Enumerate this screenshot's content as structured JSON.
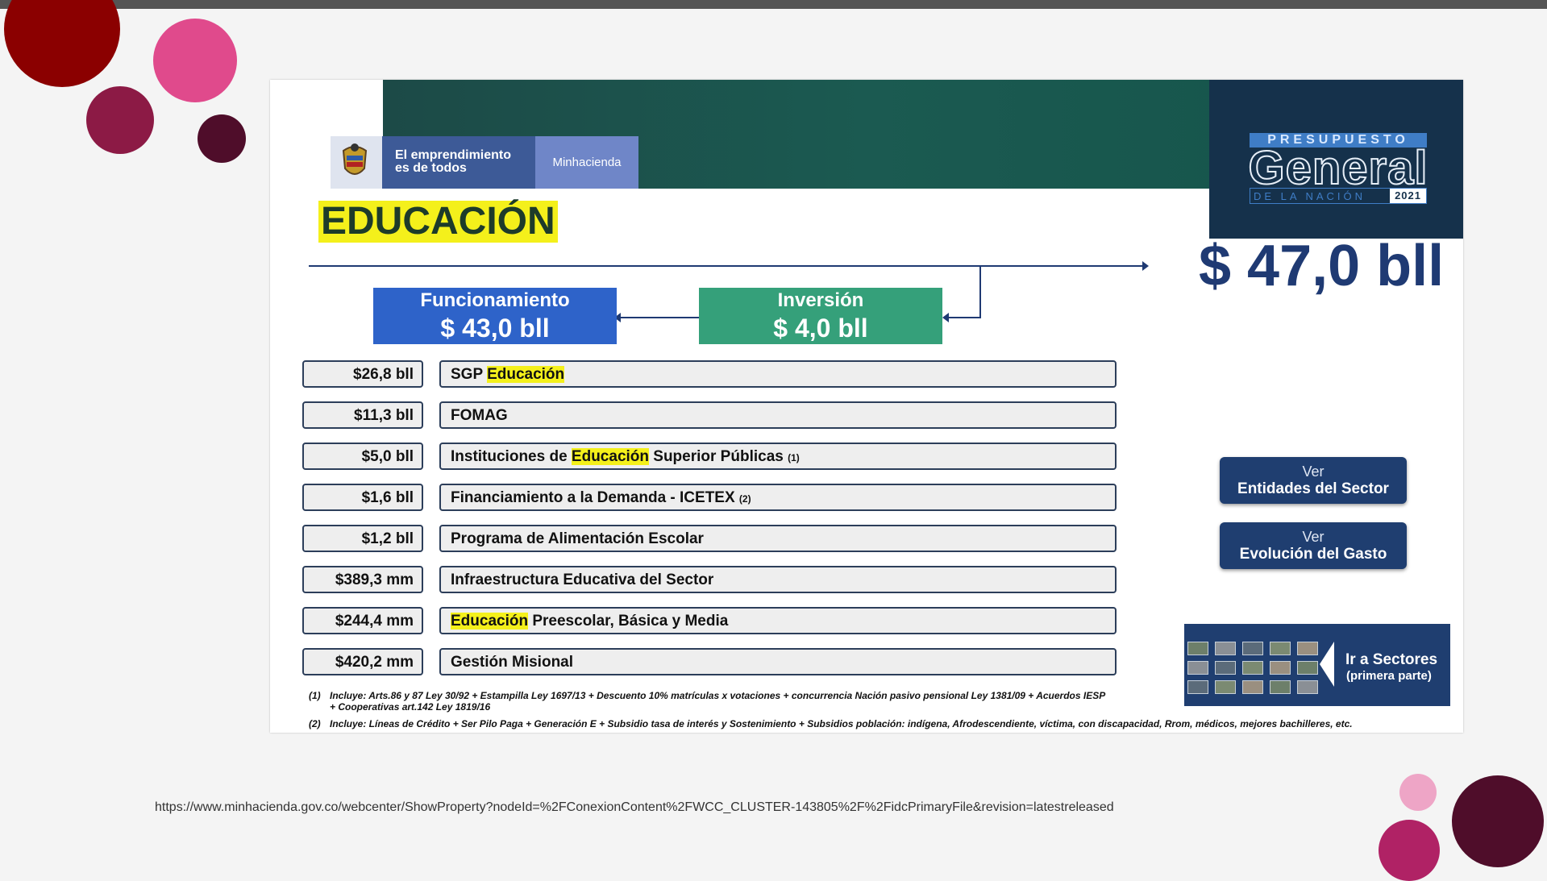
{
  "slide": {
    "header": {
      "logo_text_line1": "El emprendimiento",
      "logo_text_line2": "es de todos",
      "ministry": "Minhacienda",
      "budget_badge": {
        "top": "PRESUPUESTO",
        "main": "General",
        "bottom": "DE LA NACIÓN",
        "year": "2021"
      }
    },
    "title": "EDUCACIÓN",
    "total": "$ 47,0 bll",
    "funcionamiento": {
      "label": "Funcionamiento",
      "value": "$ 43,0 bll"
    },
    "inversion": {
      "label": "Inversión",
      "value": "$ 4,0 bll"
    },
    "rows": [
      {
        "amount": "$26,8 bll",
        "pre": "SGP ",
        "hl": "Educación",
        "post": "",
        "note": ""
      },
      {
        "amount": "$11,3 bll",
        "pre": "FOMAG",
        "hl": "",
        "post": "",
        "note": ""
      },
      {
        "amount": "$5,0 bll",
        "pre": "Instituciones de ",
        "hl": "Educación",
        "post": " Superior Públicas ",
        "note": "(1)"
      },
      {
        "amount": "$1,6 bll",
        "pre": "Financiamiento a la Demanda - ICETEX ",
        "hl": "",
        "post": "",
        "note": "(2)"
      },
      {
        "amount": "$1,2 bll",
        "pre": "Programa de Alimentación Escolar",
        "hl": "",
        "post": "",
        "note": ""
      },
      {
        "amount": "$389,3 mm",
        "pre": "Infraestructura Educativa del Sector",
        "hl": "",
        "post": "",
        "note": ""
      },
      {
        "amount": "$244,4 mm",
        "pre": "",
        "hl": "Educación",
        "post": " Preescolar, Básica y Media",
        "note": ""
      },
      {
        "amount": "$420,2 mm",
        "pre": "Gestión Misional",
        "hl": "",
        "post": "",
        "note": ""
      }
    ],
    "buttons": {
      "entidades": {
        "line1": "Ver",
        "line2": "Entidades del Sector"
      },
      "evolucion": {
        "line1": "Ver",
        "line2": "Evolución del Gasto"
      }
    },
    "sectors": {
      "line1": "Ir a Sectores",
      "line2": "(primera parte)"
    },
    "footnotes": {
      "n1_label": "(1)",
      "n1_line1": "Incluye: Arts.86 y 87 Ley 30/92 + Estampilla Ley 1697/13 + Descuento 10% matrículas x votaciones + concurrencia Nación pasivo pensional Ley 1381/09 + Acuerdos IESP",
      "n1_line2": "+ Cooperativas art.142 Ley 1819/16",
      "n2_label": "(2)",
      "n2_line1": "Incluye: Líneas de Crédito + Ser Pilo Paga + Generación E + Subsidio tasa de interés y Sostenimiento + Subsidios población: indígena,  Afrodescendiente, víctima, con discapacidad, Rrom, médicos, mejores bachilleres, etc."
    }
  },
  "source_url": "https://www.minhacienda.gov.co/webcenter/ShowProperty?nodeId=%2FConexionContent%2FWCC_CLUSTER-143805%2F%2FidcPrimaryFile&revision=latestreleased",
  "colors": {
    "dark_red": "#8b0000",
    "pink": "#e04a8c",
    "maroon": "#8c1a45",
    "dark_maroon": "#4f0d2a",
    "highlight": "#f4f01b",
    "funcionamiento": "#2e63c9",
    "inversion": "#35a07a",
    "navy": "#1f3e70"
  }
}
